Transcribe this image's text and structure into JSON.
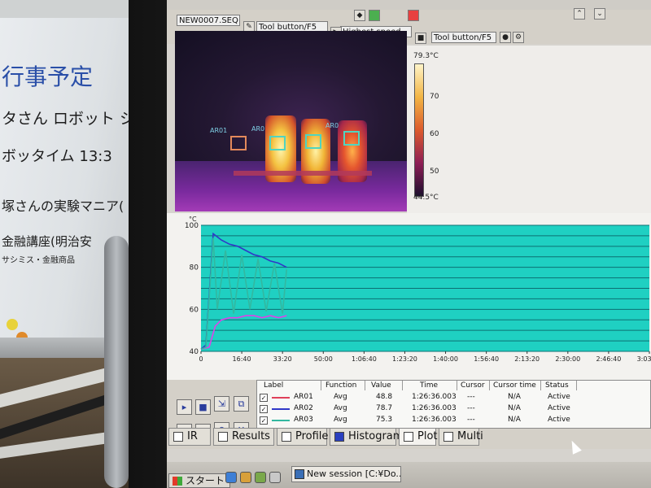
{
  "whiteboard": {
    "lines": [
      "行事予定",
      "タさん ロボット ジョイス",
      "ボッタイム 13:3",
      "塚さんの実験マニア(",
      "金融講座(明治安",
      "サシミス・金融商品"
    ]
  },
  "toolbar": {
    "sequence_file": "NEW0007.SEQ",
    "tool_button_1": "Tool button/F5",
    "speed": "Highest speed",
    "tool_button_2": "Tool button/F5"
  },
  "thermal": {
    "roi_labels": [
      "AR01",
      "AR0",
      "AR0"
    ],
    "scale": {
      "max": "79.3°C",
      "min": "44.5°C",
      "ticks": [
        "70",
        "60",
        "50"
      ]
    }
  },
  "colors": {
    "plot_bg": "#1fd0c2",
    "ar01": "#e0405a",
    "ar02": "#3038c8",
    "ar03": "#33b8a0",
    "pink": "#e040e8"
  },
  "chart_data": {
    "type": "line",
    "ylabel": "°C",
    "ylim": [
      40,
      100
    ],
    "yticks": [
      "100",
      "80",
      "60",
      "40"
    ],
    "xticks": [
      "0",
      "16:40",
      "33:20",
      "50:00",
      "1:06:40",
      "1:23:20",
      "1:40:00",
      "1:56:40",
      "2:13:20",
      "2:30:00",
      "2:46:40",
      "3:03:20"
    ],
    "xlim_seconds": [
      0,
      11000
    ],
    "series": [
      {
        "color": "#3038c8",
        "x": [
          0,
          120,
          300,
          500,
          700,
          900,
          1100,
          1300,
          1500,
          1700,
          1900,
          2000,
          2100
        ],
        "y": [
          41,
          43,
          96,
          93,
          91,
          90,
          88,
          86,
          85,
          83,
          82,
          81,
          80
        ]
      },
      {
        "color": "#e040e8",
        "x": [
          0,
          200,
          350,
          500,
          700,
          900,
          1100,
          1300,
          1500,
          1700,
          1900,
          2100
        ],
        "y": [
          41,
          42,
          52,
          55,
          56,
          56,
          57,
          57,
          56,
          57,
          56,
          57
        ]
      },
      {
        "color": "#33b8a0",
        "x": [
          0,
          120,
          300,
          400,
          600,
          800,
          1000,
          1200,
          1400,
          1600,
          1800,
          2000,
          2100
        ],
        "y": [
          41,
          42,
          94,
          60,
          88,
          58,
          86,
          60,
          84,
          59,
          82,
          58,
          79
        ]
      }
    ]
  },
  "table": {
    "headers": [
      "Label",
      "Function",
      "Value",
      "Time",
      "Cursor",
      "Cursor time",
      "Status"
    ],
    "rows": [
      {
        "label": "AR01",
        "function": "Avg",
        "value": "48.8",
        "time": "1:26:36.003",
        "cursor": "---",
        "cursor_time": "N/A",
        "status": "Active",
        "check": "✓"
      },
      {
        "label": "AR02",
        "function": "Avg",
        "value": "78.7",
        "time": "1:26:36.003",
        "cursor": "---",
        "cursor_time": "N/A",
        "status": "Active",
        "check": "✓"
      },
      {
        "label": "AR03",
        "function": "Avg",
        "value": "75.3",
        "time": "1:26:36.003",
        "cursor": "---",
        "cursor_time": "N/A",
        "status": "Active",
        "check": "✓"
      }
    ]
  },
  "tabs": [
    "IR",
    "Results",
    "Profile",
    "Histogram",
    "Plot",
    "Multi"
  ],
  "taskbar": {
    "start": "スタート",
    "session": "New session [C:¥Do..."
  }
}
